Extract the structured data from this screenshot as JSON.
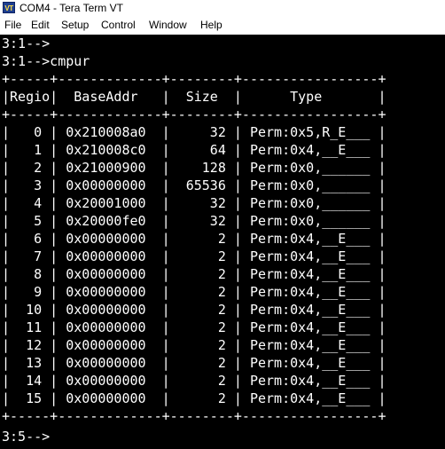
{
  "window": {
    "icon_text": "VT",
    "title": "COM4 - Tera Term VT"
  },
  "menu": {
    "items": [
      "File",
      "Edit",
      "Setup",
      "Control",
      "Window",
      "Help"
    ]
  },
  "terminal": {
    "lines": [
      "3:1-->",
      "3:1-->cmpur",
      "+-----+-------------+--------+-----------------+",
      "|Regio|  BaseAddr   |  Size  |      Type       |",
      "+-----+-------------+--------+-----------------+",
      "|   0 | 0x210008a0  |     32 | Perm:0x5,R_E___ |",
      "|   1 | 0x210008c0  |     64 | Perm:0x4,__E___ |",
      "|   2 | 0x21000900  |    128 | Perm:0x0,______ |",
      "|   3 | 0x00000000  |  65536 | Perm:0x0,______ |",
      "|   4 | 0x20001000  |     32 | Perm:0x0,______ |",
      "|   5 | 0x20000fe0  |     32 | Perm:0x0,______ |",
      "|   6 | 0x00000000  |      2 | Perm:0x4,__E___ |",
      "|   7 | 0x00000000  |      2 | Perm:0x4,__E___ |",
      "|   8 | 0x00000000  |      2 | Perm:0x4,__E___ |",
      "|   9 | 0x00000000  |      2 | Perm:0x4,__E___ |",
      "|  10 | 0x00000000  |      2 | Perm:0x4,__E___ |",
      "|  11 | 0x00000000  |      2 | Perm:0x4,__E___ |",
      "|  12 | 0x00000000  |      2 | Perm:0x4,__E___ |",
      "|  13 | 0x00000000  |      2 | Perm:0x4,__E___ |",
      "|  14 | 0x00000000  |      2 | Perm:0x4,__E___ |",
      "|  15 | 0x00000000  |      2 | Perm:0x4,__E___ |",
      "+-----+-------------+--------+-----------------+",
      "",
      "3:5-->"
    ]
  },
  "colors": {
    "terminal_background": "#000000",
    "terminal_text": "#ffffff",
    "window_chrome": "#ffffff"
  },
  "icons": {
    "app": "tera-term-vt-icon"
  }
}
